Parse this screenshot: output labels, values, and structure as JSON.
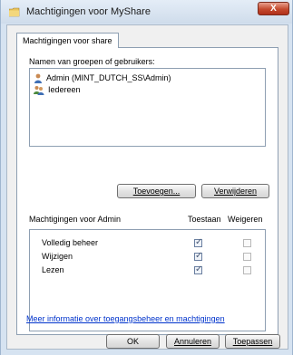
{
  "window": {
    "title": "Machtigingen voor MyShare",
    "close_label": "X"
  },
  "tab": {
    "label": "Machtigingen voor share"
  },
  "groups": {
    "label": "Namen van groepen of gebruikers:",
    "items": [
      {
        "name": "Admin (MINT_DUTCH_SS\\Admin)",
        "icon": "single-user-icon"
      },
      {
        "name": "Iedereen",
        "icon": "group-users-icon"
      }
    ],
    "add_button": "Toevoegen...",
    "remove_button": "Verwijderen"
  },
  "permissions": {
    "header": "Machtigingen voor Admin",
    "allow_header": "Toestaan",
    "deny_header": "Weigeren",
    "rows": [
      {
        "name": "Volledig beheer",
        "allow": true,
        "deny": false
      },
      {
        "name": "Wijzigen",
        "allow": true,
        "deny": false
      },
      {
        "name": "Lezen",
        "allow": true,
        "deny": false
      }
    ]
  },
  "link": {
    "text": "Meer informatie over toegangsbeheer en machtigingen"
  },
  "footer": {
    "ok": "OK",
    "cancel": "Annuleren",
    "apply": "Toepassen"
  }
}
